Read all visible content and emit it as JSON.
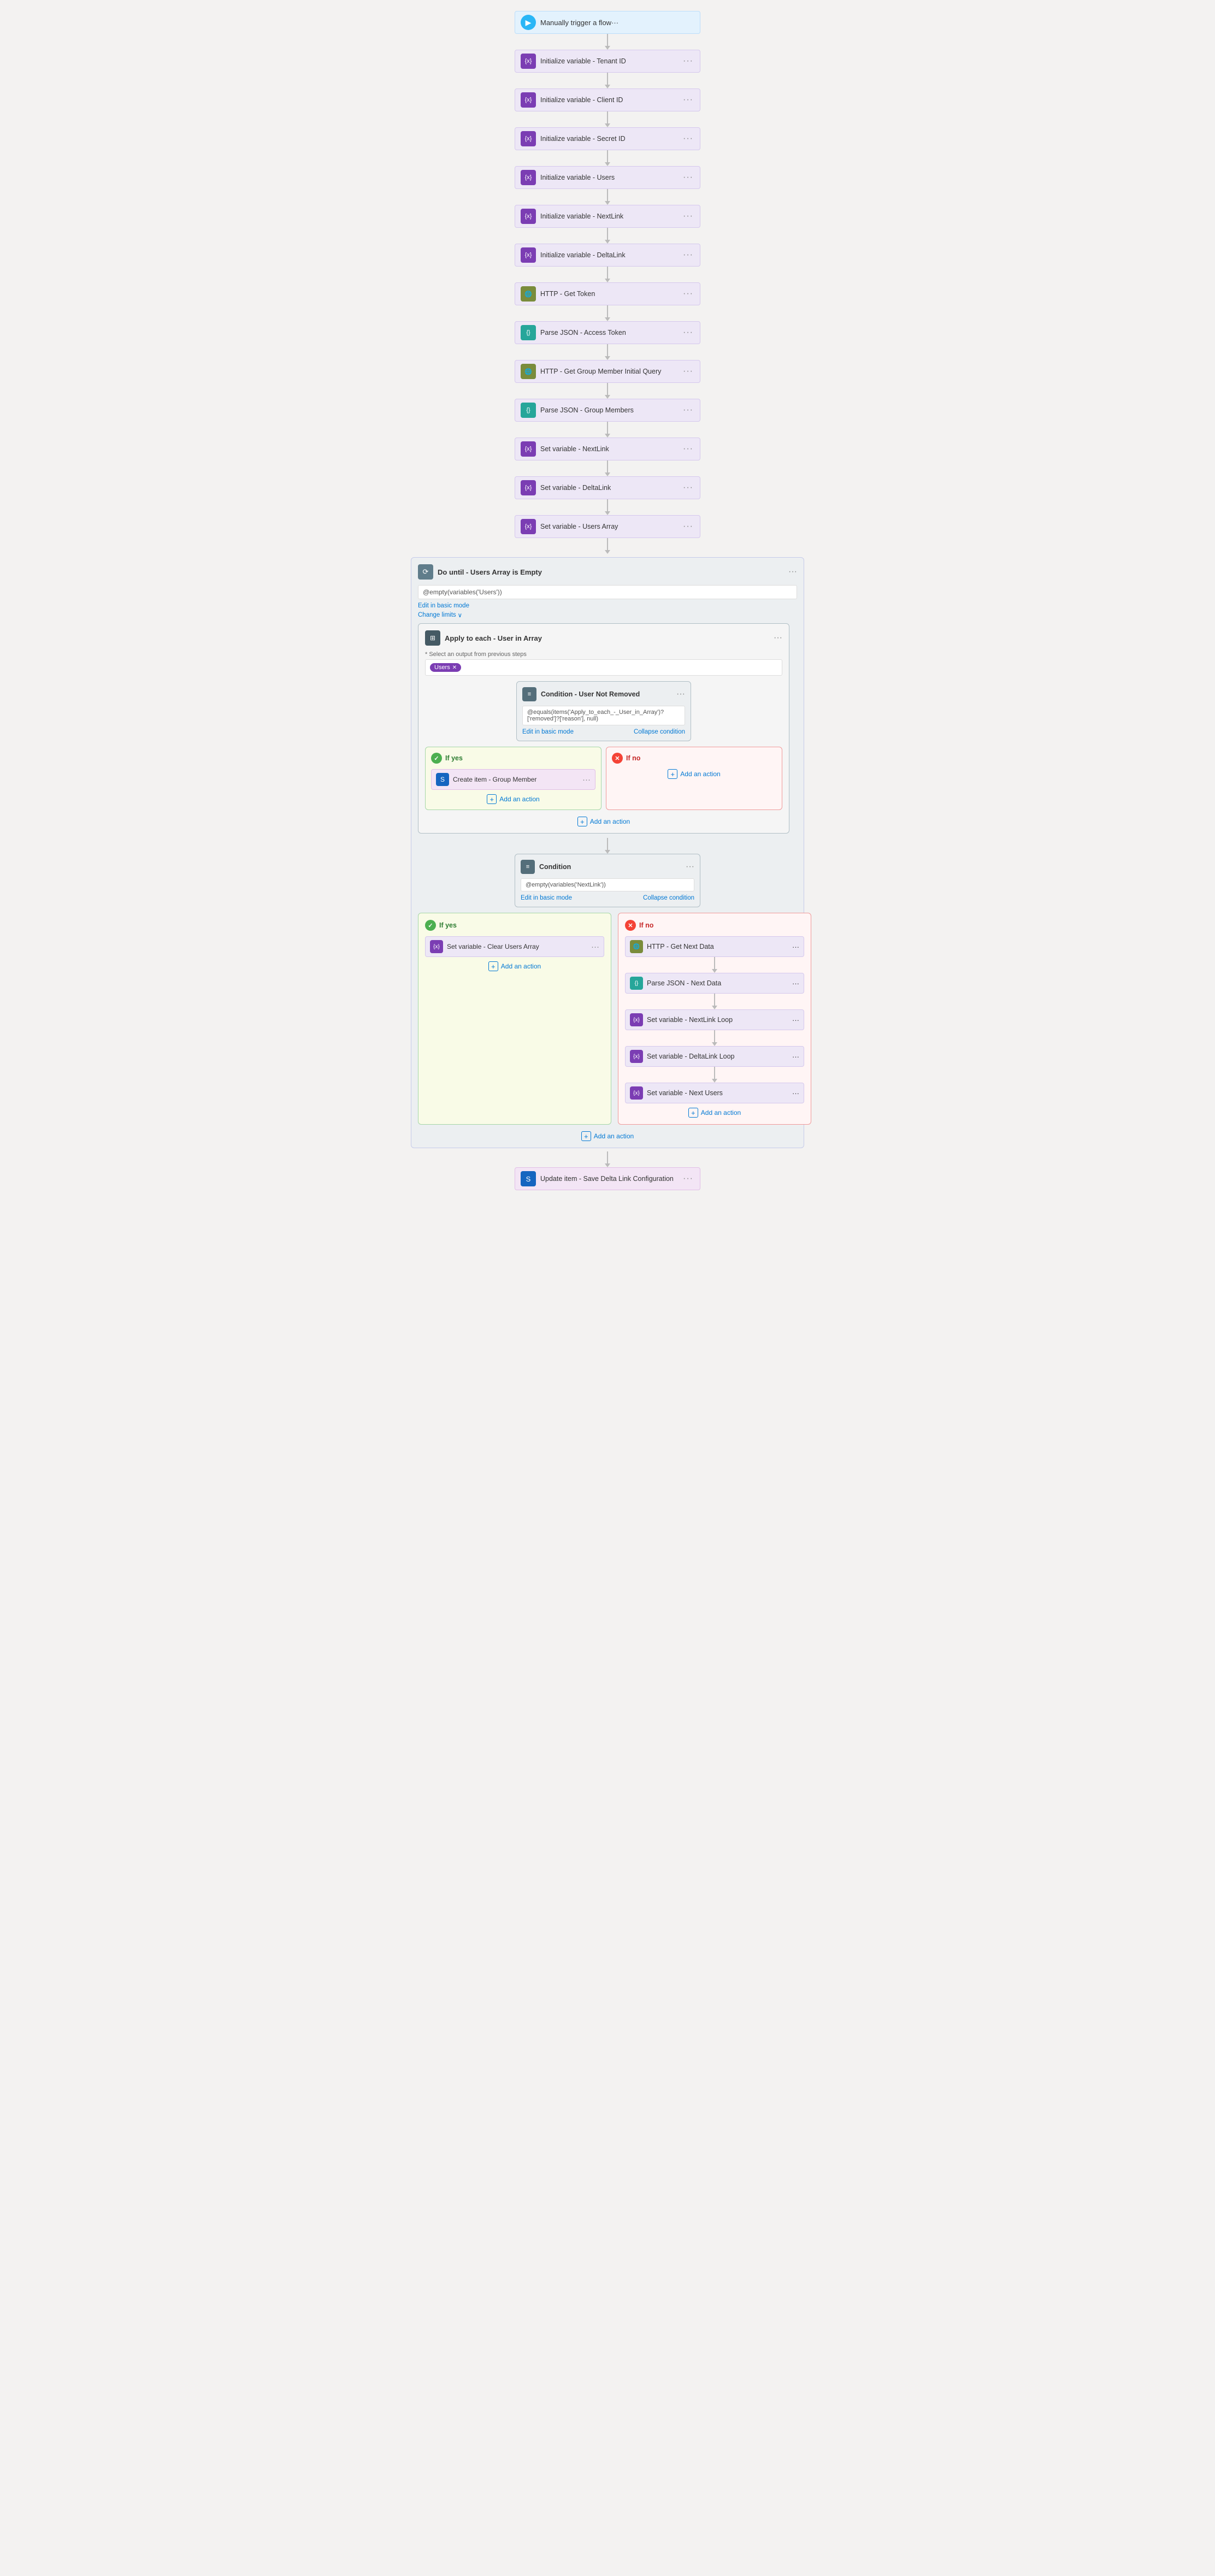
{
  "trigger": {
    "label": "Manually trigger a flow",
    "icon": "▶"
  },
  "actions": [
    {
      "id": "init-tenant",
      "label": "Initialize variable - Tenant ID",
      "icon": "{x}",
      "color": "purple"
    },
    {
      "id": "init-client",
      "label": "Initialize variable - Client ID",
      "icon": "{x}",
      "color": "purple"
    },
    {
      "id": "init-secret",
      "label": "Initialize variable - Secret ID",
      "icon": "{x}",
      "color": "purple"
    },
    {
      "id": "init-users",
      "label": "Initialize variable - Users",
      "icon": "{x}",
      "color": "purple"
    },
    {
      "id": "init-nextlink",
      "label": "Initialize variable - NextLink",
      "icon": "{x}",
      "color": "purple"
    },
    {
      "id": "init-deltalink",
      "label": "Initialize variable - DeltaLink",
      "icon": "{x}",
      "color": "purple"
    },
    {
      "id": "http-token",
      "label": "HTTP - Get Token",
      "icon": "🌐",
      "color": "olive"
    },
    {
      "id": "parse-token",
      "label": "Parse JSON - Access Token",
      "icon": "{}",
      "color": "teal"
    },
    {
      "id": "http-group",
      "label": "HTTP - Get Group Member Initial Query",
      "icon": "🌐",
      "color": "olive"
    },
    {
      "id": "parse-group",
      "label": "Parse JSON - Group Members",
      "icon": "{}",
      "color": "teal"
    },
    {
      "id": "set-nextlink",
      "label": "Set variable - NextLink",
      "icon": "{x}",
      "color": "purple"
    },
    {
      "id": "set-deltalink",
      "label": "Set variable - DeltaLink",
      "icon": "{x}",
      "color": "purple"
    },
    {
      "id": "set-users-arr",
      "label": "Set variable - Users Array",
      "icon": "{x}",
      "color": "purple"
    }
  ],
  "dountil": {
    "title": "Do until - Users Array is Empty",
    "condition_expr": "@empty(variables('Users'))",
    "edit_link": "Edit in basic mode",
    "change_limits": "Change limits",
    "apply_each": {
      "title": "Apply to each - User in Array",
      "select_label": "* Select an output from previous steps",
      "select_value": "Users",
      "condition": {
        "title": "Condition - User Not Removed",
        "expr": "@equals(items('Apply_to_each_-_User_in_Array')?['removed']?['reason'], null)",
        "edit_link": "Edit in basic mode",
        "collapse_link": "Collapse condition"
      },
      "branch_yes_label": "If yes",
      "branch_no_label": "If no",
      "branch_yes_action": {
        "label": "Create item - Group Member",
        "icon": "S",
        "color": "blue"
      },
      "add_action_yes": "Add an action",
      "add_action_no": "Add an action"
    },
    "add_action_apply": "Add an action"
  },
  "outer_condition": {
    "title": "Condition",
    "expr": "@empty(variables('NextLink'))",
    "edit_link": "Edit in basic mode",
    "collapse_link": "Collapse condition",
    "branch_yes_label": "If yes",
    "branch_no_label": "If no",
    "branch_yes": {
      "action": {
        "label": "Set variable - Clear Users Array",
        "icon": "{x}",
        "color": "purple"
      },
      "add_action": "Add an action"
    },
    "branch_no": {
      "actions": [
        {
          "id": "http-next",
          "label": "HTTP - Get Next Data",
          "icon": "🌐",
          "color": "olive"
        },
        {
          "id": "parse-next",
          "label": "Parse JSON - Next Data",
          "icon": "{}",
          "color": "teal"
        },
        {
          "id": "set-nextlink-loop",
          "label": "Set variable - NextLink Loop",
          "icon": "{x}",
          "color": "purple"
        },
        {
          "id": "set-deltalink-loop",
          "label": "Set variable - DeltaLink Loop",
          "icon": "{x}",
          "color": "purple"
        },
        {
          "id": "set-next-users",
          "label": "Set variable - Next Users",
          "icon": "{x}",
          "color": "purple"
        }
      ],
      "add_action": "Add an action"
    }
  },
  "add_action_dountil": "Add an action",
  "final_action": {
    "label": "Update item - Save Delta Link Configuration",
    "icon": "S",
    "color": "blue"
  },
  "ui": {
    "more_btn": "···",
    "add_icon": "⊞"
  }
}
